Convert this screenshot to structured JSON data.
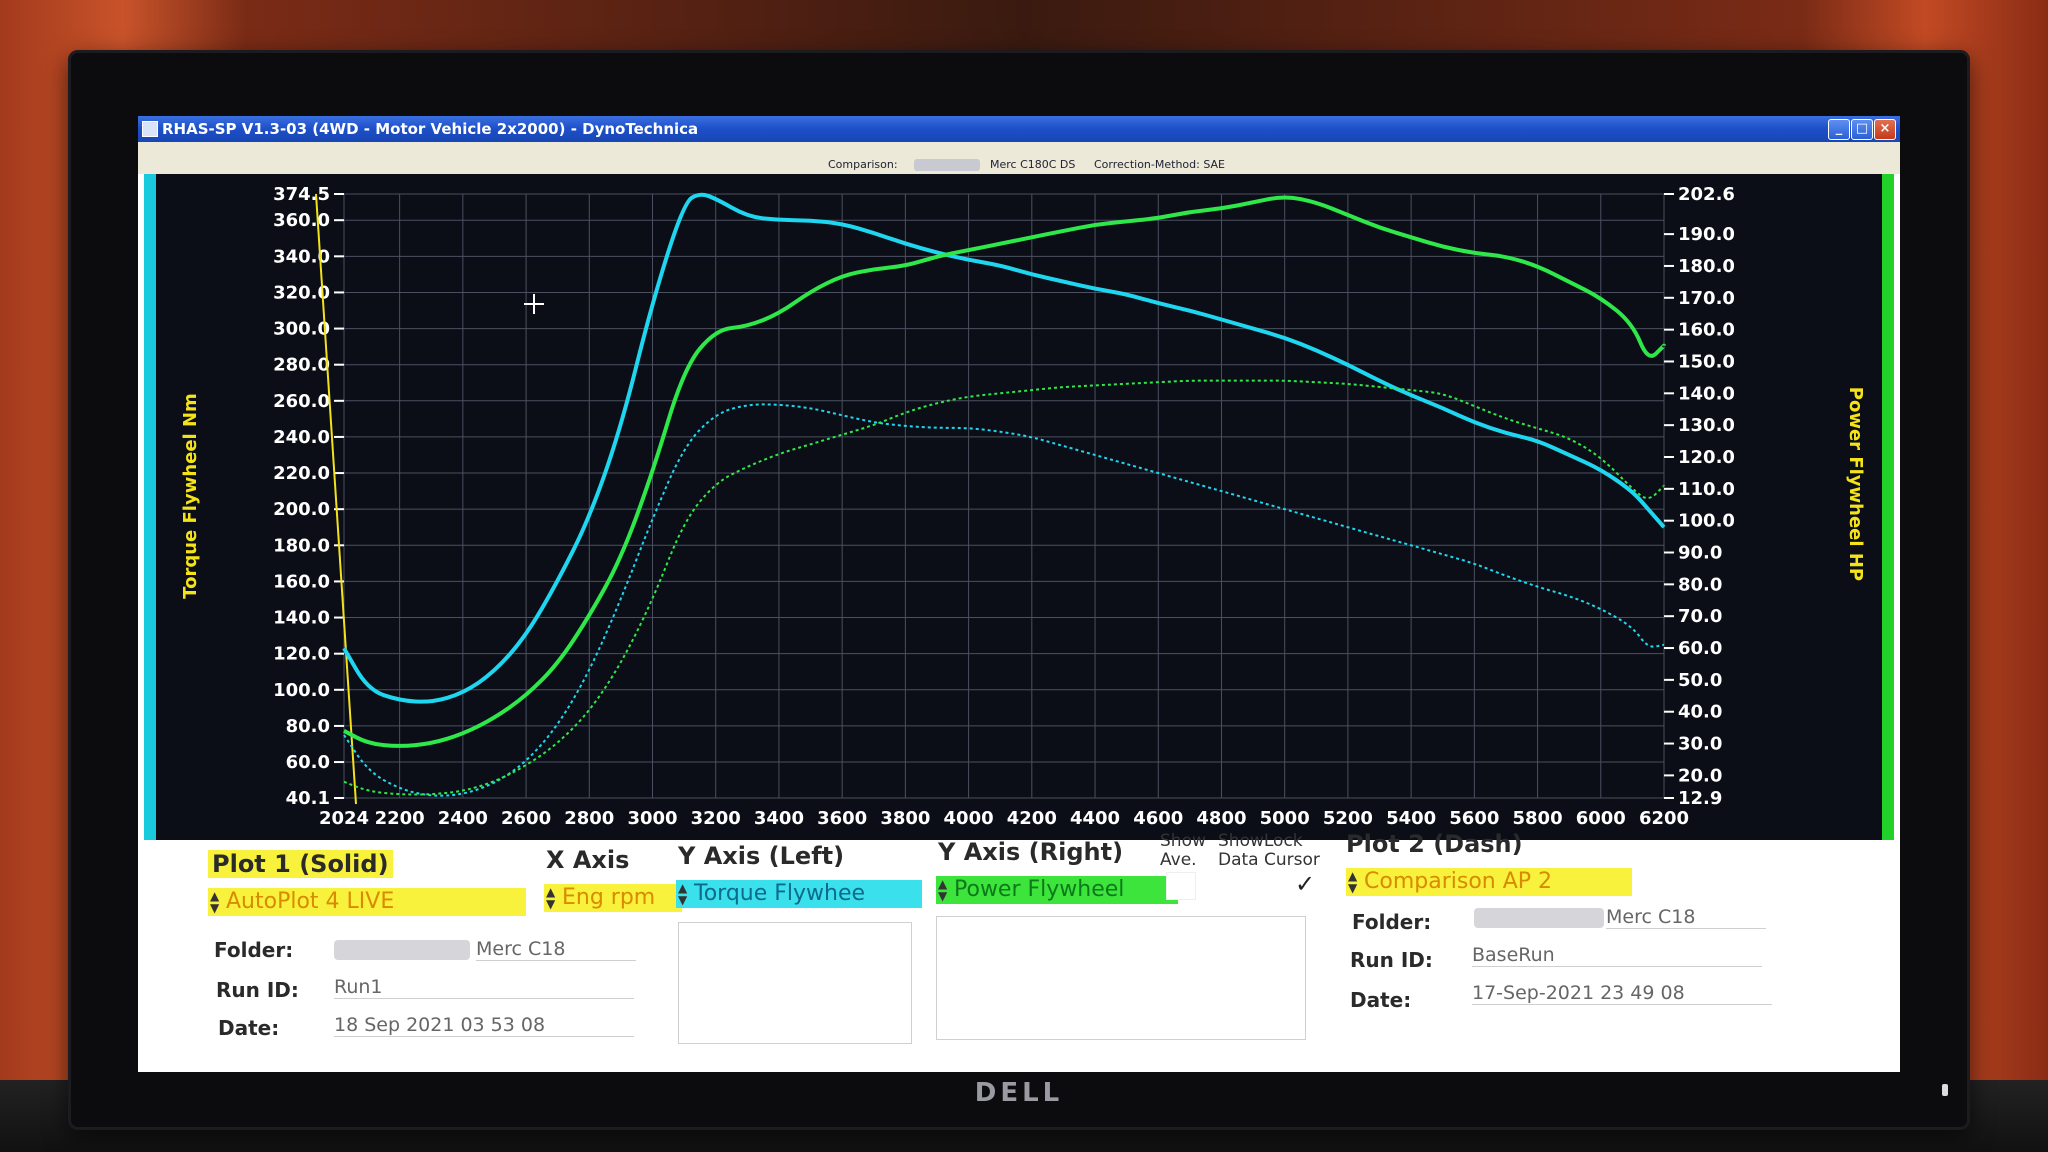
{
  "window": {
    "title": "RHAS-SP V1.3-03  (4WD - Motor Vehicle 2x2000) - DynoTechnica",
    "min": "_",
    "max": "□",
    "close": "×"
  },
  "infobar": {
    "comparison_label": "Comparison:",
    "vehicle": "Merc C180C DS",
    "correction": "Correction-Method: SAE"
  },
  "monitor": {
    "brand": "DELL"
  },
  "colors": {
    "torque": "#1fd6f0",
    "power": "#2ee84a",
    "cursor": "#f2e21a",
    "grid": "#4a5060",
    "axis_text": "#ffffff",
    "axis_title": "#f4e318"
  },
  "chart_data": {
    "type": "line",
    "x_axis": {
      "min": 2024,
      "max": 6200,
      "tick_labels": [
        "2024",
        "2200",
        "2400",
        "2600",
        "2800",
        "3000",
        "3200",
        "3400",
        "3600",
        "3800",
        "4000",
        "4200",
        "4400",
        "4600",
        "4800",
        "5000",
        "5200",
        "5400",
        "5600",
        "5800",
        "6000",
        "6200"
      ]
    },
    "y_left": {
      "title": "Torque Flywheel Nm",
      "min": 40.1,
      "max": 374.5,
      "tick_labels": [
        "374.5",
        "360.0",
        "340.0",
        "320.0",
        "300.0",
        "280.0",
        "260.0",
        "240.0",
        "220.0",
        "200.0",
        "180.0",
        "160.0",
        "140.0",
        "120.0",
        "100.0",
        "80.0",
        "60.0",
        "40.1"
      ]
    },
    "y_right": {
      "title": "Power Flywheel HP",
      "min": 12.9,
      "max": 202.6,
      "tick_labels": [
        "202.6",
        "190.0",
        "180.0",
        "170.0",
        "160.0",
        "150.0",
        "140.0",
        "130.0",
        "120.0",
        "110.0",
        "100.0",
        "90.0",
        "80.0",
        "70.0",
        "60.0",
        "50.0",
        "40.0",
        "30.0",
        "20.0",
        "12.9"
      ]
    },
    "cursor_x": 2024,
    "grid": true,
    "series": [
      {
        "name": "Torque Flywheel",
        "run": "AutoPlot 4 LIVE",
        "style": "solid",
        "axis": "left",
        "x": [
          2024,
          2100,
          2200,
          2300,
          2400,
          2500,
          2600,
          2700,
          2800,
          2900,
          3000,
          3100,
          3150,
          3200,
          3300,
          3400,
          3500,
          3600,
          3700,
          3800,
          3900,
          4000,
          4100,
          4200,
          4300,
          4400,
          4500,
          4600,
          4700,
          4800,
          4900,
          5000,
          5100,
          5200,
          5300,
          5400,
          5500,
          5600,
          5700,
          5800,
          5900,
          6000,
          6100,
          6150,
          6200
        ],
        "y": [
          123,
          100,
          94,
          93,
          98,
          110,
          130,
          160,
          195,
          245,
          315,
          370,
          375,
          372,
          362,
          360,
          360,
          358,
          353,
          347,
          342,
          338,
          335,
          330,
          326,
          322,
          319,
          314,
          310,
          305,
          300,
          295,
          288,
          280,
          271,
          263,
          256,
          248,
          242,
          238,
          230,
          222,
          210,
          200,
          190
        ]
      },
      {
        "name": "Power Flywheel",
        "run": "AutoPlot 4 LIVE",
        "style": "solid",
        "axis": "right",
        "x": [
          2024,
          2100,
          2200,
          2300,
          2400,
          2500,
          2600,
          2700,
          2800,
          2900,
          3000,
          3100,
          3200,
          3300,
          3400,
          3500,
          3600,
          3700,
          3800,
          3900,
          4000,
          4100,
          4200,
          4300,
          4400,
          4500,
          4600,
          4700,
          4800,
          4900,
          5000,
          5100,
          5200,
          5300,
          5400,
          5500,
          5600,
          5700,
          5800,
          5900,
          6000,
          6100,
          6150,
          6200
        ],
        "y": [
          34,
          30,
          29,
          30,
          33,
          38,
          45,
          55,
          70,
          88,
          115,
          148,
          160,
          161,
          165,
          172,
          177,
          179,
          180,
          183,
          185,
          187,
          189,
          191,
          193,
          194,
          195,
          197,
          198,
          200,
          202,
          200,
          196,
          192,
          189,
          186,
          184,
          183,
          180,
          175,
          170,
          162,
          150,
          155
        ]
      },
      {
        "name": "Torque Flywheel",
        "run": "Comparison AP 2",
        "style": "dash",
        "axis": "left",
        "x": [
          2024,
          2100,
          2200,
          2300,
          2400,
          2500,
          2600,
          2700,
          2800,
          2900,
          3000,
          3100,
          3200,
          3300,
          3400,
          3500,
          3600,
          3700,
          3800,
          3900,
          4000,
          4100,
          4200,
          4300,
          4400,
          4500,
          4600,
          4700,
          4800,
          4900,
          5000,
          5100,
          5200,
          5300,
          5400,
          5500,
          5600,
          5700,
          5800,
          5900,
          6000,
          6100,
          6150,
          6200
        ],
        "y": [
          75,
          55,
          45,
          41,
          42,
          48,
          60,
          80,
          110,
          150,
          195,
          235,
          253,
          258,
          258,
          256,
          252,
          248,
          246,
          245,
          245,
          243,
          240,
          235,
          230,
          225,
          220,
          215,
          210,
          205,
          200,
          195,
          190,
          185,
          180,
          175,
          170,
          163,
          157,
          152,
          145,
          135,
          123,
          125
        ]
      },
      {
        "name": "Power Flywheel",
        "run": "Comparison AP 2",
        "style": "dash",
        "axis": "right",
        "x": [
          2024,
          2100,
          2200,
          2300,
          2400,
          2500,
          2600,
          2700,
          2800,
          2900,
          3000,
          3100,
          3200,
          3300,
          3400,
          3500,
          3600,
          3700,
          3800,
          3900,
          4000,
          4100,
          4200,
          4300,
          4400,
          4500,
          4600,
          4700,
          4800,
          4900,
          5000,
          5100,
          5200,
          5300,
          5400,
          5500,
          5600,
          5700,
          5800,
          5900,
          6000,
          6100,
          6150,
          6200
        ],
        "y": [
          18,
          15,
          14,
          14,
          15,
          18,
          23,
          30,
          40,
          55,
          75,
          100,
          112,
          117,
          121,
          124,
          127,
          130,
          134,
          137,
          139,
          140,
          141,
          142,
          142.5,
          143,
          143.5,
          144,
          144,
          144,
          144,
          143.5,
          143,
          142,
          141,
          140,
          136,
          132,
          129,
          126,
          120,
          110,
          106,
          111
        ]
      }
    ]
  },
  "plot1": {
    "title": "Plot 1 (Solid)",
    "run_select": "AutoPlot 4 LIVE",
    "folder_label": "Folder:",
    "folder_value": "Merc C18",
    "runid_label": "Run ID:",
    "runid_value": "Run1",
    "date_label": "Date:",
    "date_value": "18 Sep 2021  03 53 08"
  },
  "x_axis_panel": {
    "title": "X Axis",
    "select": "Eng rpm"
  },
  "y_left_panel": {
    "title": "Y Axis (Left)",
    "select": "Torque Flywhee"
  },
  "y_right_panel": {
    "title": "Y Axis (Right)",
    "select": "Power Flywheel"
  },
  "show_ave": {
    "label_top": "Show",
    "label_bottom": "Ave."
  },
  "show_cursor": {
    "label_top": "ShowLock",
    "label_bottom": "Data Cursor",
    "checked": "✓"
  },
  "plot2": {
    "title": "Plot 2 (Dash)",
    "run_select": "Comparison AP 2",
    "folder_label": "Folder:",
    "folder_value": "Merc C18",
    "runid_label": "Run ID:",
    "runid_value": "BaseRun",
    "date_label": "Date:",
    "date_value": "17-Sep-2021  23 49 08"
  }
}
